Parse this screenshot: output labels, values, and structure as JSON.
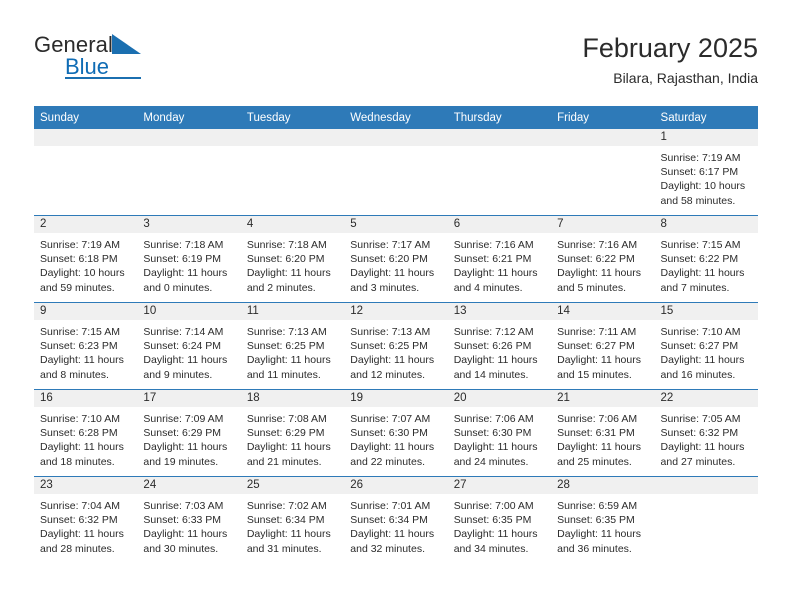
{
  "brand": {
    "word_one": "General",
    "word_two": "Blue",
    "flag_icon": "triangle-flag-icon"
  },
  "header": {
    "title": "February 2025",
    "subtitle": "Bilara, Rajasthan, India"
  },
  "colors": {
    "header_blue": "#2e7ab8",
    "brand_blue": "#0f6cb5",
    "daynum_bg": "#f0f0f0",
    "text": "#2b2b2b"
  },
  "weekday_headers": [
    "Sunday",
    "Monday",
    "Tuesday",
    "Wednesday",
    "Thursday",
    "Friday",
    "Saturday"
  ],
  "weeks": [
    [
      {
        "day": "",
        "blank": true,
        "sunrise": "",
        "sunset": "",
        "daylight_1": "",
        "daylight_2": ""
      },
      {
        "day": "",
        "blank": true,
        "sunrise": "",
        "sunset": "",
        "daylight_1": "",
        "daylight_2": ""
      },
      {
        "day": "",
        "blank": true,
        "sunrise": "",
        "sunset": "",
        "daylight_1": "",
        "daylight_2": ""
      },
      {
        "day": "",
        "blank": true,
        "sunrise": "",
        "sunset": "",
        "daylight_1": "",
        "daylight_2": ""
      },
      {
        "day": "",
        "blank": true,
        "sunrise": "",
        "sunset": "",
        "daylight_1": "",
        "daylight_2": ""
      },
      {
        "day": "",
        "blank": true,
        "sunrise": "",
        "sunset": "",
        "daylight_1": "",
        "daylight_2": ""
      },
      {
        "day": "1",
        "blank": false,
        "sunrise": "Sunrise: 7:19 AM",
        "sunset": "Sunset: 6:17 PM",
        "daylight_1": "Daylight: 10 hours",
        "daylight_2": "and 58 minutes."
      }
    ],
    [
      {
        "day": "2",
        "blank": false,
        "sunrise": "Sunrise: 7:19 AM",
        "sunset": "Sunset: 6:18 PM",
        "daylight_1": "Daylight: 10 hours",
        "daylight_2": "and 59 minutes."
      },
      {
        "day": "3",
        "blank": false,
        "sunrise": "Sunrise: 7:18 AM",
        "sunset": "Sunset: 6:19 PM",
        "daylight_1": "Daylight: 11 hours",
        "daylight_2": "and 0 minutes."
      },
      {
        "day": "4",
        "blank": false,
        "sunrise": "Sunrise: 7:18 AM",
        "sunset": "Sunset: 6:20 PM",
        "daylight_1": "Daylight: 11 hours",
        "daylight_2": "and 2 minutes."
      },
      {
        "day": "5",
        "blank": false,
        "sunrise": "Sunrise: 7:17 AM",
        "sunset": "Sunset: 6:20 PM",
        "daylight_1": "Daylight: 11 hours",
        "daylight_2": "and 3 minutes."
      },
      {
        "day": "6",
        "blank": false,
        "sunrise": "Sunrise: 7:16 AM",
        "sunset": "Sunset: 6:21 PM",
        "daylight_1": "Daylight: 11 hours",
        "daylight_2": "and 4 minutes."
      },
      {
        "day": "7",
        "blank": false,
        "sunrise": "Sunrise: 7:16 AM",
        "sunset": "Sunset: 6:22 PM",
        "daylight_1": "Daylight: 11 hours",
        "daylight_2": "and 5 minutes."
      },
      {
        "day": "8",
        "blank": false,
        "sunrise": "Sunrise: 7:15 AM",
        "sunset": "Sunset: 6:22 PM",
        "daylight_1": "Daylight: 11 hours",
        "daylight_2": "and 7 minutes."
      }
    ],
    [
      {
        "day": "9",
        "blank": false,
        "sunrise": "Sunrise: 7:15 AM",
        "sunset": "Sunset: 6:23 PM",
        "daylight_1": "Daylight: 11 hours",
        "daylight_2": "and 8 minutes."
      },
      {
        "day": "10",
        "blank": false,
        "sunrise": "Sunrise: 7:14 AM",
        "sunset": "Sunset: 6:24 PM",
        "daylight_1": "Daylight: 11 hours",
        "daylight_2": "and 9 minutes."
      },
      {
        "day": "11",
        "blank": false,
        "sunrise": "Sunrise: 7:13 AM",
        "sunset": "Sunset: 6:25 PM",
        "daylight_1": "Daylight: 11 hours",
        "daylight_2": "and 11 minutes."
      },
      {
        "day": "12",
        "blank": false,
        "sunrise": "Sunrise: 7:13 AM",
        "sunset": "Sunset: 6:25 PM",
        "daylight_1": "Daylight: 11 hours",
        "daylight_2": "and 12 minutes."
      },
      {
        "day": "13",
        "blank": false,
        "sunrise": "Sunrise: 7:12 AM",
        "sunset": "Sunset: 6:26 PM",
        "daylight_1": "Daylight: 11 hours",
        "daylight_2": "and 14 minutes."
      },
      {
        "day": "14",
        "blank": false,
        "sunrise": "Sunrise: 7:11 AM",
        "sunset": "Sunset: 6:27 PM",
        "daylight_1": "Daylight: 11 hours",
        "daylight_2": "and 15 minutes."
      },
      {
        "day": "15",
        "blank": false,
        "sunrise": "Sunrise: 7:10 AM",
        "sunset": "Sunset: 6:27 PM",
        "daylight_1": "Daylight: 11 hours",
        "daylight_2": "and 16 minutes."
      }
    ],
    [
      {
        "day": "16",
        "blank": false,
        "sunrise": "Sunrise: 7:10 AM",
        "sunset": "Sunset: 6:28 PM",
        "daylight_1": "Daylight: 11 hours",
        "daylight_2": "and 18 minutes."
      },
      {
        "day": "17",
        "blank": false,
        "sunrise": "Sunrise: 7:09 AM",
        "sunset": "Sunset: 6:29 PM",
        "daylight_1": "Daylight: 11 hours",
        "daylight_2": "and 19 minutes."
      },
      {
        "day": "18",
        "blank": false,
        "sunrise": "Sunrise: 7:08 AM",
        "sunset": "Sunset: 6:29 PM",
        "daylight_1": "Daylight: 11 hours",
        "daylight_2": "and 21 minutes."
      },
      {
        "day": "19",
        "blank": false,
        "sunrise": "Sunrise: 7:07 AM",
        "sunset": "Sunset: 6:30 PM",
        "daylight_1": "Daylight: 11 hours",
        "daylight_2": "and 22 minutes."
      },
      {
        "day": "20",
        "blank": false,
        "sunrise": "Sunrise: 7:06 AM",
        "sunset": "Sunset: 6:30 PM",
        "daylight_1": "Daylight: 11 hours",
        "daylight_2": "and 24 minutes."
      },
      {
        "day": "21",
        "blank": false,
        "sunrise": "Sunrise: 7:06 AM",
        "sunset": "Sunset: 6:31 PM",
        "daylight_1": "Daylight: 11 hours",
        "daylight_2": "and 25 minutes."
      },
      {
        "day": "22",
        "blank": false,
        "sunrise": "Sunrise: 7:05 AM",
        "sunset": "Sunset: 6:32 PM",
        "daylight_1": "Daylight: 11 hours",
        "daylight_2": "and 27 minutes."
      }
    ],
    [
      {
        "day": "23",
        "blank": false,
        "sunrise": "Sunrise: 7:04 AM",
        "sunset": "Sunset: 6:32 PM",
        "daylight_1": "Daylight: 11 hours",
        "daylight_2": "and 28 minutes."
      },
      {
        "day": "24",
        "blank": false,
        "sunrise": "Sunrise: 7:03 AM",
        "sunset": "Sunset: 6:33 PM",
        "daylight_1": "Daylight: 11 hours",
        "daylight_2": "and 30 minutes."
      },
      {
        "day": "25",
        "blank": false,
        "sunrise": "Sunrise: 7:02 AM",
        "sunset": "Sunset: 6:34 PM",
        "daylight_1": "Daylight: 11 hours",
        "daylight_2": "and 31 minutes."
      },
      {
        "day": "26",
        "blank": false,
        "sunrise": "Sunrise: 7:01 AM",
        "sunset": "Sunset: 6:34 PM",
        "daylight_1": "Daylight: 11 hours",
        "daylight_2": "and 32 minutes."
      },
      {
        "day": "27",
        "blank": false,
        "sunrise": "Sunrise: 7:00 AM",
        "sunset": "Sunset: 6:35 PM",
        "daylight_1": "Daylight: 11 hours",
        "daylight_2": "and 34 minutes."
      },
      {
        "day": "28",
        "blank": false,
        "sunrise": "Sunrise: 6:59 AM",
        "sunset": "Sunset: 6:35 PM",
        "daylight_1": "Daylight: 11 hours",
        "daylight_2": "and 36 minutes."
      },
      {
        "day": "",
        "blank": true,
        "sunrise": "",
        "sunset": "",
        "daylight_1": "",
        "daylight_2": ""
      }
    ]
  ]
}
